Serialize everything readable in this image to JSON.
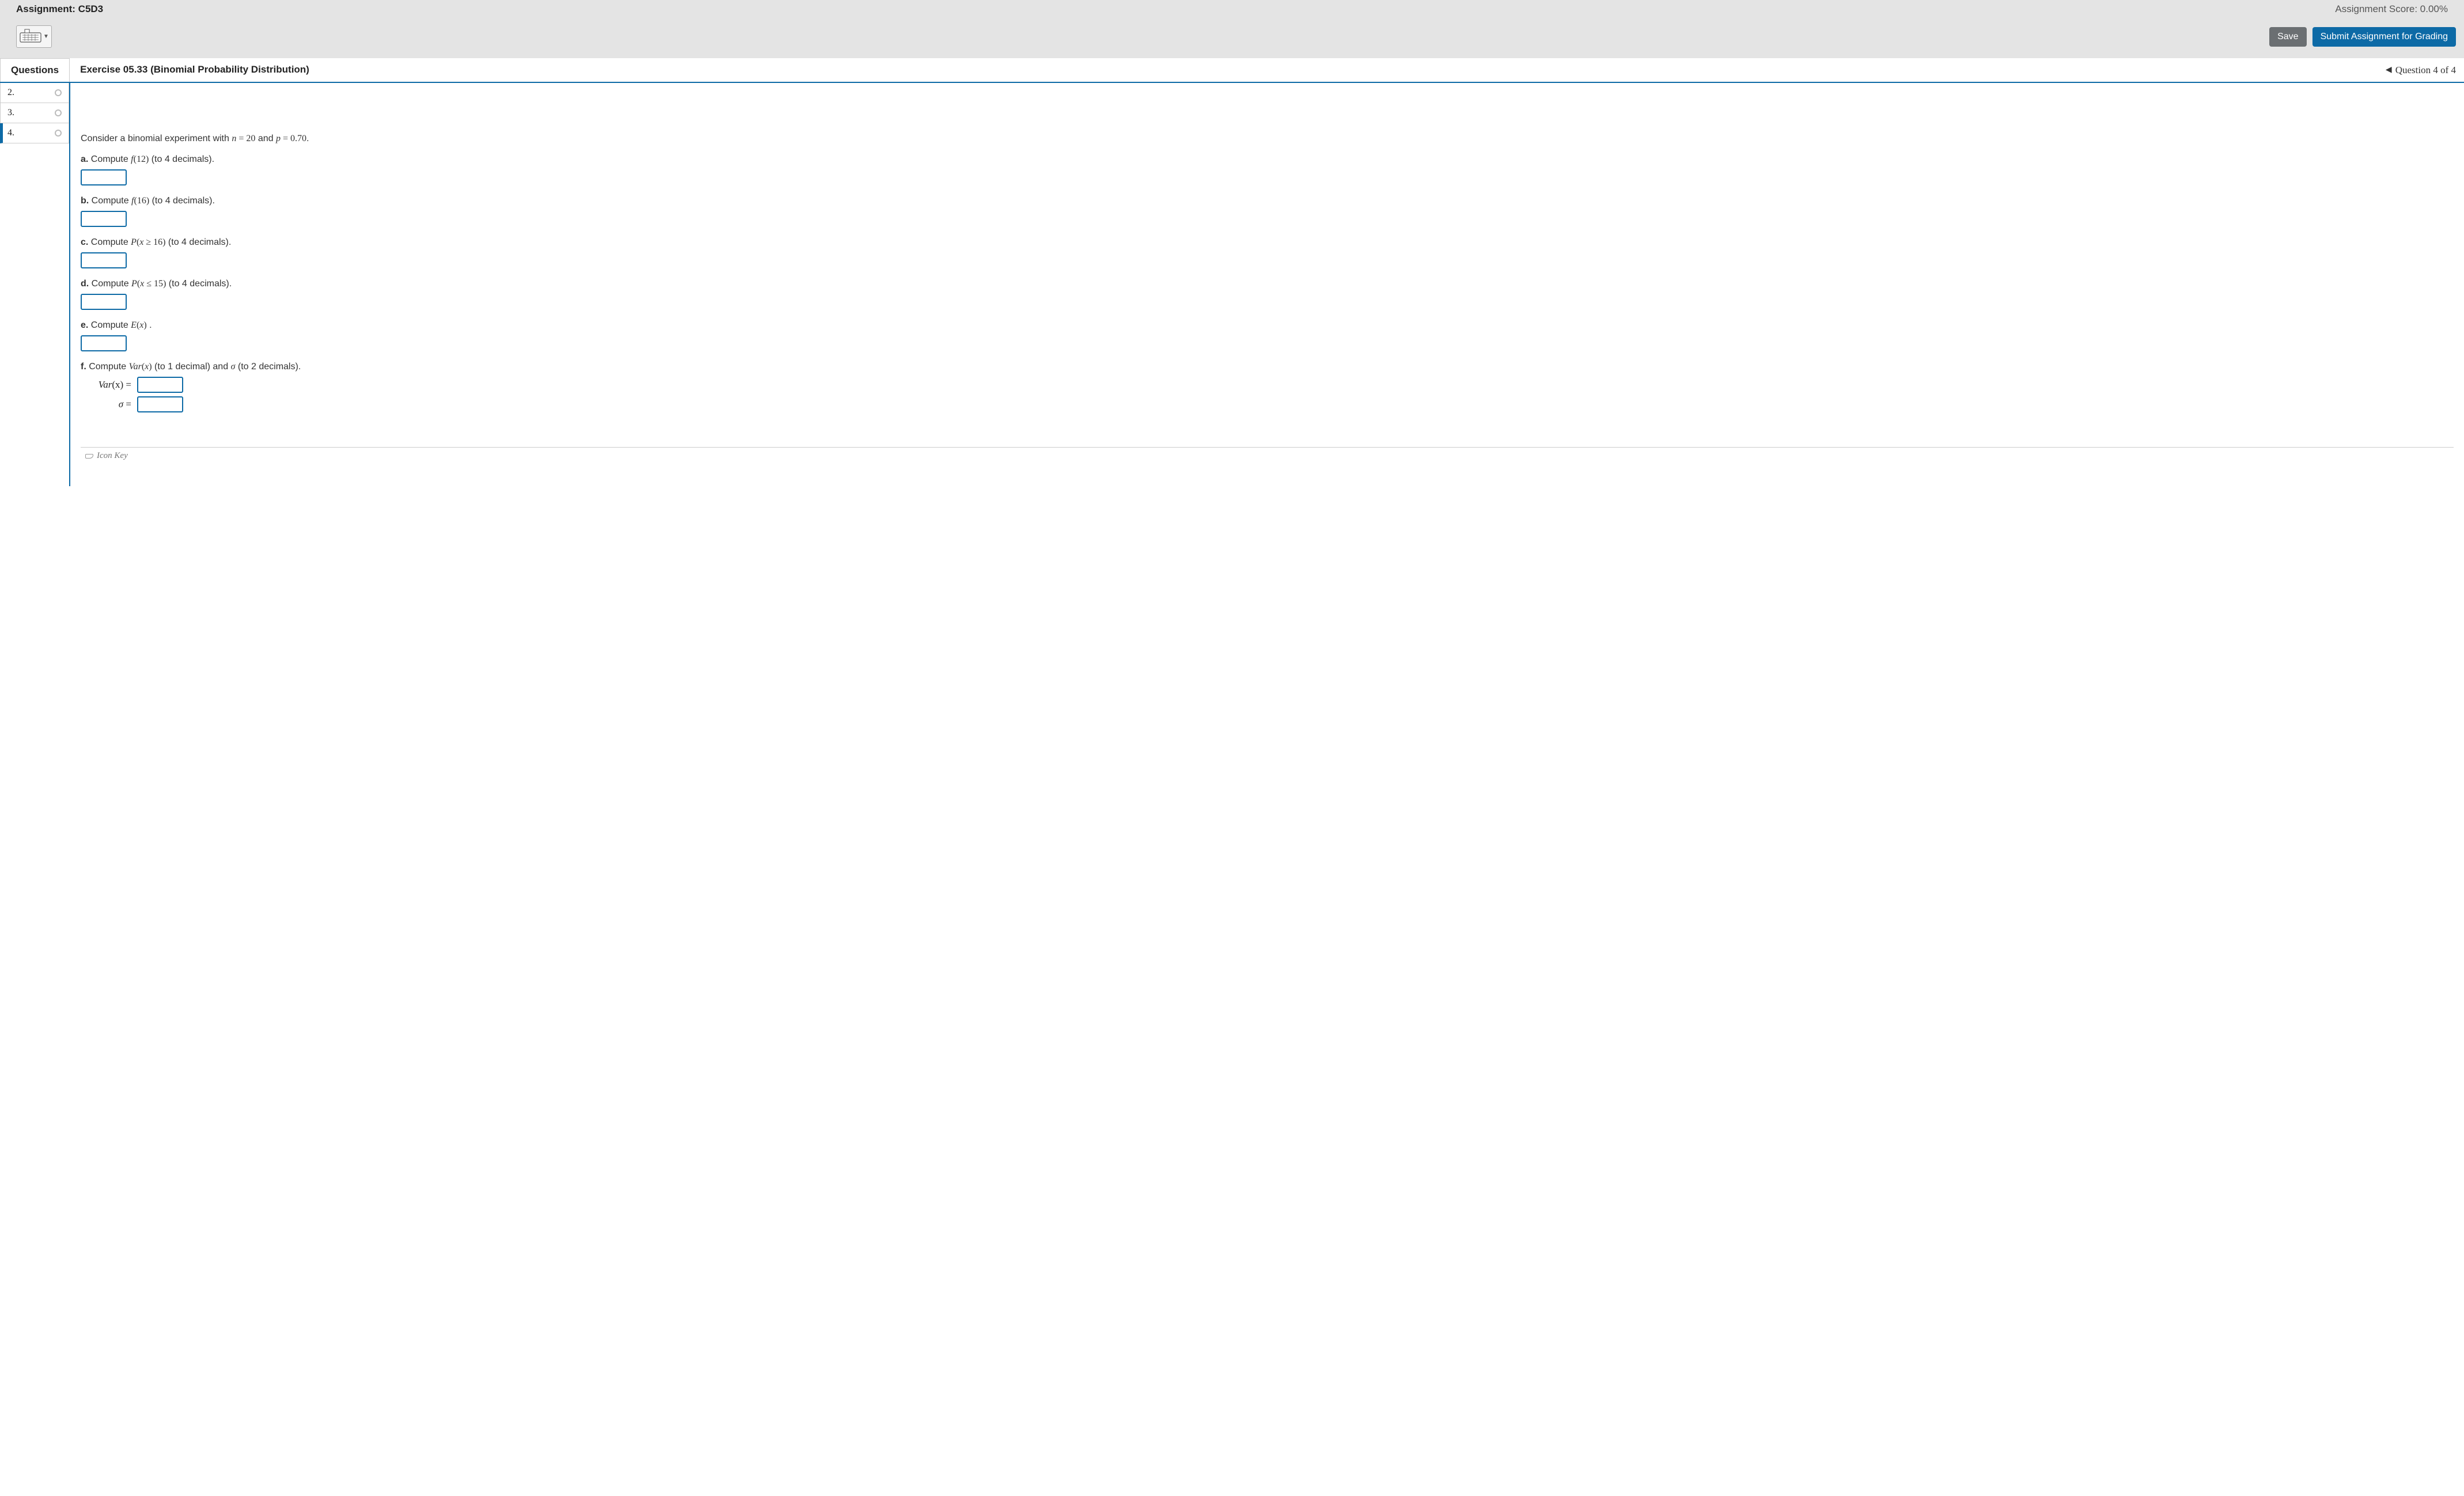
{
  "header": {
    "assignment_label": "Assignment: C5D3",
    "score_label": "Assignment Score: 0.00%",
    "save_label": "Save",
    "submit_label": "Submit Assignment for Grading"
  },
  "nav": {
    "questions_hdr": "Questions",
    "exercise_title": "Exercise 05.33 (Binomial Probability Distribution)",
    "position_text": "Question 4 of 4"
  },
  "sidebar": {
    "items": [
      {
        "num": "2."
      },
      {
        "num": "3."
      },
      {
        "num": "4."
      }
    ]
  },
  "problem": {
    "intro_pre": "Consider a binomial experiment with ",
    "n_sym": "n",
    "eq": " = ",
    "n_val": "20",
    "and": " and ",
    "p_sym": "p",
    "p_val": "0.70",
    "period": ".",
    "parts": {
      "a": {
        "label": "a.",
        "text_pre": " Compute ",
        "fn": "f",
        "arg": "(12)",
        "suffix": " (to 4 decimals)."
      },
      "b": {
        "label": "b.",
        "text_pre": " Compute ",
        "fn": "f",
        "arg": "(16)",
        "suffix": " (to 4 decimals)."
      },
      "c": {
        "label": "c.",
        "text_pre": " Compute ",
        "fn": "P",
        "arg_pre": "(",
        "var": "x",
        "rel": " ≥ ",
        "val": "16",
        "arg_post": ")",
        "suffix": " (to 4 decimals)."
      },
      "d": {
        "label": "d.",
        "text_pre": " Compute ",
        "fn": "P",
        "arg_pre": "(",
        "var": "x",
        "rel": " ≤ ",
        "val": "15",
        "arg_post": ")",
        "suffix": " (to 4 decimals)."
      },
      "e": {
        "label": "e.",
        "text_pre": " Compute ",
        "fn": "E",
        "arg_pre": "(",
        "var": "x",
        "arg_post": ")",
        "suffix": " ."
      },
      "f": {
        "label": "f.",
        "text_pre": " Compute ",
        "fn": "Var",
        "arg_pre": "(",
        "var": "x",
        "arg_post": ")",
        "mid": " (to 1 decimal) and ",
        "sigma": "σ",
        "suffix": " (to 2 decimals)."
      }
    },
    "f_rows": {
      "var_label_fn": "Var",
      "var_label_arg": "(x)",
      "eq": " = ",
      "sigma": "σ"
    }
  },
  "footer": {
    "icon_key": "Icon Key"
  }
}
